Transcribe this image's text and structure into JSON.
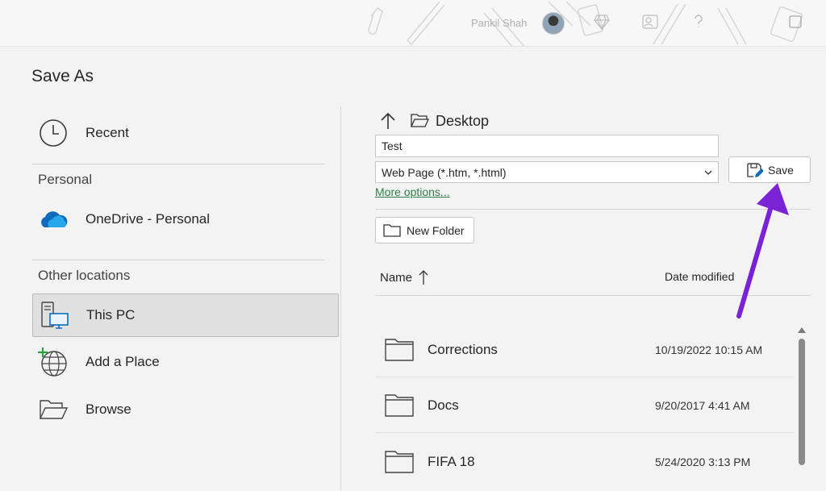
{
  "titlebar": {
    "user_name": "Pankil Shah",
    "icons": [
      "paperclip-doodle-icon",
      "pen-doodle-icon",
      "diamond-icon",
      "person-card-icon",
      "help-icon",
      "window-icon"
    ]
  },
  "page": {
    "title": "Save As"
  },
  "left_nav": {
    "recent": {
      "label": "Recent",
      "icon": "clock-icon"
    },
    "personal_section": "Personal",
    "onedrive": {
      "label": "OneDrive - Personal",
      "icon": "cloud-icon"
    },
    "other_section": "Other locations",
    "this_pc": {
      "label": "This PC",
      "icon": "computer-icon",
      "selected": true
    },
    "add_place": {
      "label": "Add a Place",
      "icon": "globe-plus-icon"
    },
    "browse": {
      "label": "Browse",
      "icon": "folder-open-icon"
    }
  },
  "breadcrumb": {
    "current": "Desktop"
  },
  "file_name": {
    "value": "Test"
  },
  "file_type": {
    "selected": "Web Page (*.htm, *.html)"
  },
  "more_options": "More options...",
  "buttons": {
    "save": "Save",
    "new_folder": "New Folder"
  },
  "columns": {
    "name": "Name",
    "date_modified": "Date modified"
  },
  "files": [
    {
      "name": "Corrections",
      "date": "10/19/2022 10:15 AM"
    },
    {
      "name": "Docs",
      "date": "9/20/2017 4:41 AM"
    },
    {
      "name": "FIFA 18",
      "date": "5/24/2020 3:13 PM"
    }
  ],
  "colors": {
    "link_green": "#2e7d46",
    "annotation_purple": "#7a22d6",
    "onedrive_blue": "#0f6cbd"
  }
}
